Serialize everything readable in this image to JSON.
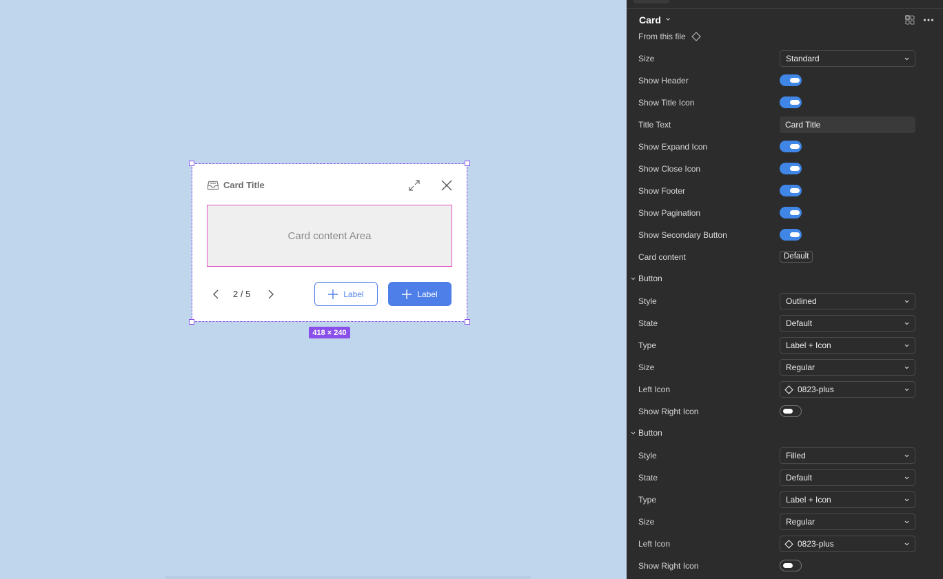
{
  "canvas": {
    "card": {
      "title": "Card Title",
      "content_text": "Card content Area",
      "pagination": "2 / 5",
      "secondary_button_label": "Label",
      "primary_button_label": "Label"
    },
    "size_badge": "418 × 240"
  },
  "panel": {
    "component_name": "Card",
    "source": "From this file",
    "properties": [
      {
        "type": "select",
        "label": "Size",
        "value": "Standard"
      },
      {
        "type": "toggle",
        "label": "Show Header",
        "on": true
      },
      {
        "type": "toggle",
        "label": "Show Title Icon",
        "on": true
      },
      {
        "type": "text",
        "label": "Title Text",
        "value": "Card Title"
      },
      {
        "type": "toggle",
        "label": "Show Expand Icon",
        "on": true
      },
      {
        "type": "toggle",
        "label": "Show Close Icon",
        "on": true
      },
      {
        "type": "toggle",
        "label": "Show Footer",
        "on": true
      },
      {
        "type": "toggle",
        "label": "Show Pagination",
        "on": true
      },
      {
        "type": "toggle",
        "label": "Show Secondary Button",
        "on": true
      },
      {
        "type": "chip",
        "label": "Card content",
        "value": "Default"
      }
    ],
    "button_sections": [
      {
        "title": "Button",
        "properties": [
          {
            "type": "select",
            "label": "Style",
            "value": "Outlined"
          },
          {
            "type": "select",
            "label": "State",
            "value": "Default"
          },
          {
            "type": "select",
            "label": "Type",
            "value": "Label + Icon"
          },
          {
            "type": "select",
            "label": "Size",
            "value": "Regular"
          },
          {
            "type": "select-icon",
            "label": "Left Icon",
            "value": "0823-plus"
          },
          {
            "type": "toggle",
            "label": "Show Right Icon",
            "on": false
          }
        ]
      },
      {
        "title": "Button",
        "properties": [
          {
            "type": "select",
            "label": "Style",
            "value": "Filled"
          },
          {
            "type": "select",
            "label": "State",
            "value": "Default"
          },
          {
            "type": "select",
            "label": "Type",
            "value": "Label + Icon"
          },
          {
            "type": "select",
            "label": "Size",
            "value": "Regular"
          },
          {
            "type": "select-icon",
            "label": "Left Icon",
            "value": "0823-plus"
          },
          {
            "type": "toggle",
            "label": "Show Right Icon",
            "on": false
          }
        ]
      }
    ]
  },
  "colors": {
    "canvas_bg": "#c0d6ec",
    "panel_bg": "#2c2c2c",
    "selection": "#8a4fe8",
    "primary": "#4e7fe8",
    "toggle_on": "#3f86e6",
    "content_border": "#e04fc0"
  },
  "icons": [
    "inbox-icon",
    "expand-icon",
    "close-icon",
    "chevron-left-icon",
    "chevron-right-icon",
    "plus-icon",
    "chevron-down-icon",
    "component-grid-icon",
    "more-icon",
    "diamond-icon"
  ]
}
